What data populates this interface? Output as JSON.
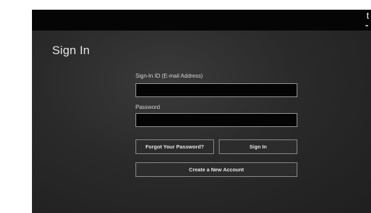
{
  "status": {
    "glyph": "ʈ"
  },
  "page": {
    "title": "Sign In"
  },
  "form": {
    "signin_id": {
      "label": "Sign-In ID (E-mail Address)",
      "value": "",
      "placeholder": ""
    },
    "password": {
      "label": "Password",
      "value": "",
      "placeholder": ""
    }
  },
  "buttons": {
    "forgot": "Forgot Your Password?",
    "signin": "Sign In",
    "create": "Create a New Account"
  }
}
